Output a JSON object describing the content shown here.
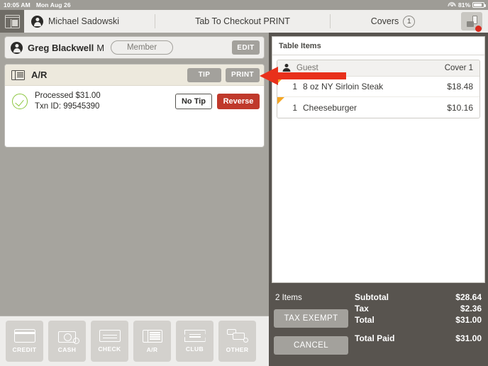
{
  "status_bar": {
    "time": "10:05 AM",
    "date": "Mon Aug 26",
    "wifi_icon": "wifi-icon",
    "battery_pct": "81%",
    "battery_icon": "battery-icon"
  },
  "topbar": {
    "register_icon": "cash-register-icon",
    "user_icon": "user-avatar-icon",
    "user_name": "Michael Sadowski",
    "center_title": "Tab To Checkout PRINT",
    "covers_label": "Covers",
    "covers_count": "1",
    "printer_icon": "printer-icon",
    "printer_badge": "alert-badge"
  },
  "member_card": {
    "avatar_icon": "user-avatar-icon",
    "name": "Greg Blackwell",
    "suffix": "M",
    "pill_label": "Member",
    "edit_label": "EDIT"
  },
  "transaction": {
    "type_icon": "ar-ticket-icon",
    "type_label": "A/R",
    "tip_label": "TIP",
    "print_label": "PRINT",
    "status_icon": "check-circle-icon",
    "status_line1": "Processed $31.00",
    "status_line2": "Txn ID: 99545390",
    "no_tip_label": "No Tip",
    "reverse_label": "Reverse",
    "reverse_color": "#c0392b",
    "check_color": "#8cc63f"
  },
  "payment_methods": [
    {
      "label": "CREDIT",
      "icon": "credit-card-icon"
    },
    {
      "label": "CASH",
      "icon": "cash-icon"
    },
    {
      "label": "CHECK",
      "icon": "check-icon"
    },
    {
      "label": "A/R",
      "icon": "ar-ticket-icon"
    },
    {
      "label": "CLUB",
      "icon": "club-ticket-icon"
    },
    {
      "label": "OTHER",
      "icon": "other-payment-icon"
    }
  ],
  "table_items": {
    "title": "Table Items",
    "cover": {
      "guest_icon": "guest-icon",
      "guest_label": "Guest",
      "cover_label": "Cover 1"
    },
    "rows": [
      {
        "qty": "1",
        "name": "8 oz NY Sirloin Steak",
        "price": "$18.48",
        "flag_color": "#f5a623"
      },
      {
        "qty": "1",
        "name": "Cheeseburger",
        "price": "$10.16",
        "flag_color": "#f5a623"
      }
    ]
  },
  "totals": {
    "items_count": "2 Items",
    "tax_exempt_label": "TAX EXEMPT",
    "cancel_label": "CANCEL",
    "subtotal_label": "Subtotal",
    "subtotal_value": "$28.64",
    "tax_label": "Tax",
    "tax_value": "$2.36",
    "total_label": "Total",
    "total_value": "$31.00",
    "total_paid_label": "Total Paid",
    "total_paid_value": "$31.00"
  },
  "annotation": {
    "arrow_icon": "red-pointer-arrow",
    "arrow_color": "#e8301b"
  }
}
